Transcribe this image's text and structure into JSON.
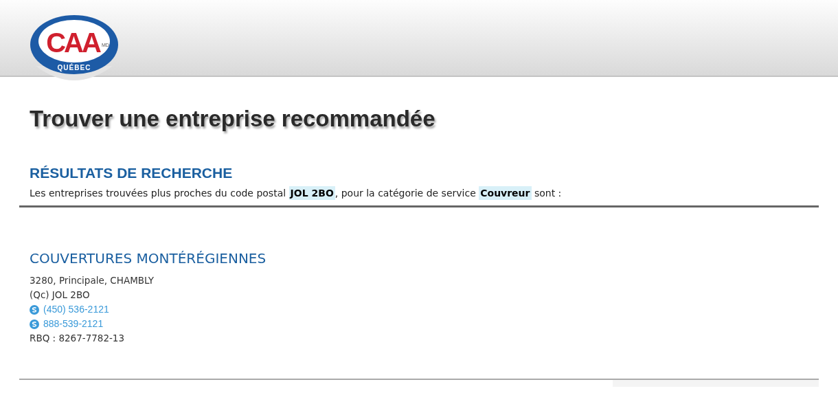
{
  "logo": {
    "letters": "CAA",
    "mark": "MD",
    "region": "QUÉBEC"
  },
  "title": "Trouver une entreprise recommandée",
  "results": {
    "heading": "RÉSULTATS DE RECHERCHE",
    "intro": [
      {
        "text": "Les entreprises trouvées plus proches du code postal ",
        "highlight": false
      },
      {
        "text": "JOL 2BO",
        "highlight": true
      },
      {
        "text": ", pour la catégorie de service ",
        "highlight": false
      },
      {
        "text": "Couvreur",
        "highlight": true
      },
      {
        "text": " sont :",
        "highlight": false
      }
    ]
  },
  "companies": [
    {
      "name": "COUVERTURES MONTÉRÉGIENNES",
      "lines": [
        {
          "kind": "text",
          "text": "3280, Principale, CHAMBLY"
        },
        {
          "kind": "text",
          "text": "(Qc) JOL 2BO"
        },
        {
          "kind": "phone",
          "text": "(450) 536-2121"
        },
        {
          "kind": "phone",
          "text": "888-539-2121"
        },
        {
          "kind": "text",
          "text": "RBQ : 8267-7782-13"
        }
      ]
    }
  ]
}
